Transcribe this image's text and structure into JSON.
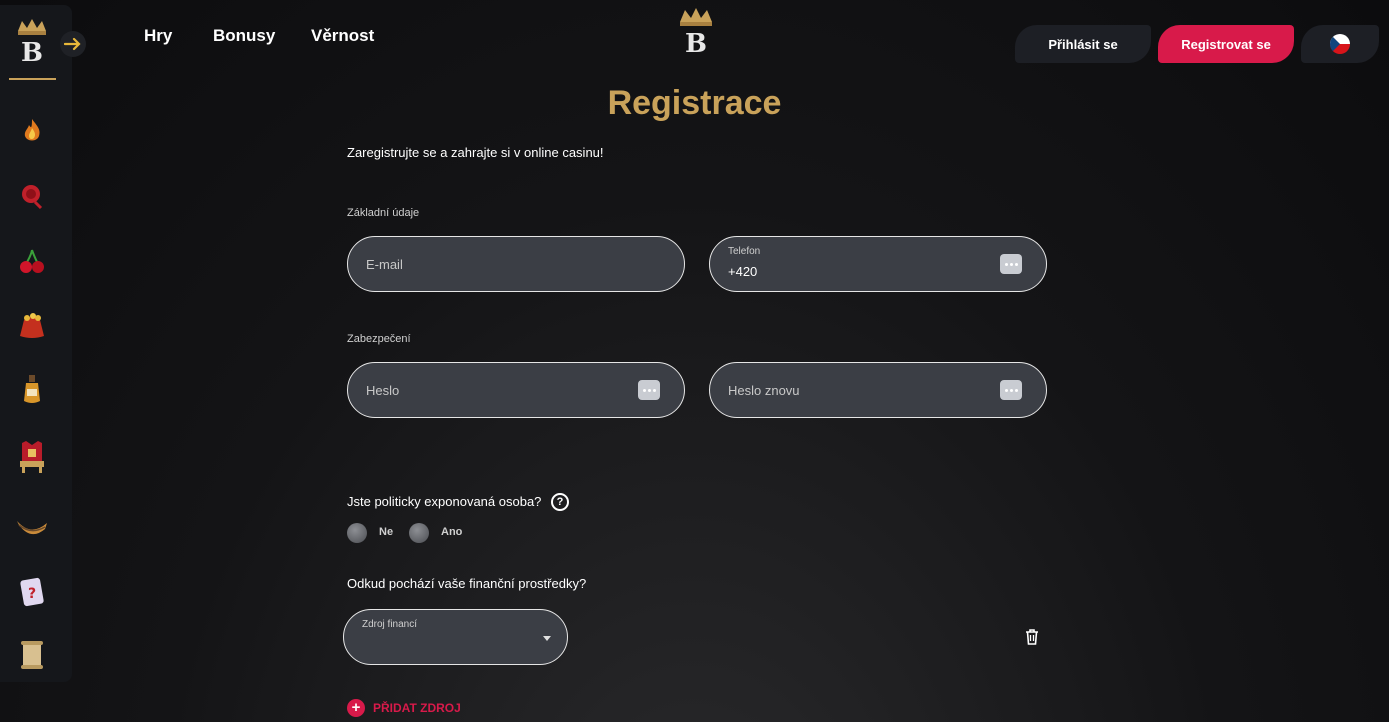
{
  "nav": {
    "links": [
      "Hry",
      "Bonusy",
      "Věrnost"
    ],
    "login_label": "Přihlásit se",
    "register_label": "Registrovat se",
    "language_icon": "czech-flag-icon"
  },
  "sidebar": {
    "items": [
      {
        "icon": "fire-icon"
      },
      {
        "icon": "wax-seal-icon"
      },
      {
        "icon": "cherry-icon"
      },
      {
        "icon": "treasure-bag-icon"
      },
      {
        "icon": "bottle-icon"
      },
      {
        "icon": "throne-icon"
      },
      {
        "icon": "horn-icon"
      },
      {
        "icon": "mystery-card-icon"
      },
      {
        "icon": "scroll-icon"
      }
    ]
  },
  "form": {
    "title": "Registrace",
    "subtitle": "Zaregistrujte se a zahrajte si v online casinu!",
    "basic_section": "Základní údaje",
    "email_placeholder": "E-mail",
    "phone_label": "Telefon",
    "phone_value": "+420",
    "security_section": "Zabezpečení",
    "password_placeholder": "Heslo",
    "password_repeat_placeholder": "Heslo znovu",
    "pep_question": "Jste politicky exponovaná osoba?",
    "pep_options": [
      "Ne",
      "Ano"
    ],
    "funds_question": "Odkud pochází vaše finanční prostředky?",
    "funds_label": "Zdroj financí",
    "add_source_label": "PŘIDAT ZDROJ"
  },
  "colors": {
    "accent_gold": "#c9a25a",
    "accent_red": "#d81a4a",
    "field_bg": "#3b3e45"
  }
}
